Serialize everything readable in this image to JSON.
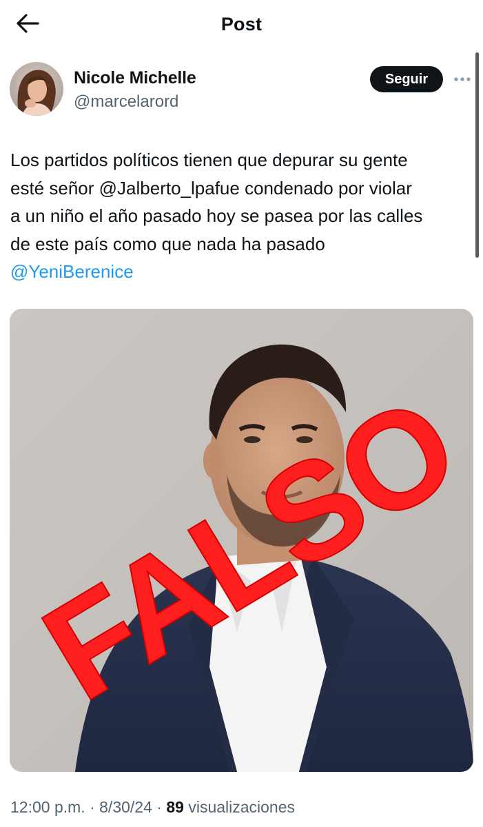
{
  "header": {
    "title": "Post",
    "back_icon": "arrow-left-icon"
  },
  "author": {
    "name": "Nicole Michelle",
    "handle": "@marcelarord",
    "follow_label": "Seguir",
    "more_icon": "more-horizontal-icon"
  },
  "tweet": {
    "line1": "Los partidos políticos tienen que depurar su gente",
    "line2_pre": "esté señor ",
    "line2_mention": "@Jalberto_lpafue",
    "line2_post": " condenado por violar",
    "line3": "a un niño el año pasado hoy se pasea por las calles",
    "line4": "de este país como que nada ha pasado",
    "line5_mention": "@YeniBerenice"
  },
  "media": {
    "stamp_text": "FALSO",
    "stamp_color": "#ff1f1f"
  },
  "meta": {
    "time": "12:00 p.m.",
    "sep1": " · ",
    "date": "8/30/24",
    "sep2": " · ",
    "views_count": "89",
    "views_label": " visualizaciones"
  },
  "colors": {
    "link": "#1d9bf0",
    "secondary_text": "#536471",
    "primary_text": "#0f1419",
    "button_bg": "#0f1419"
  }
}
